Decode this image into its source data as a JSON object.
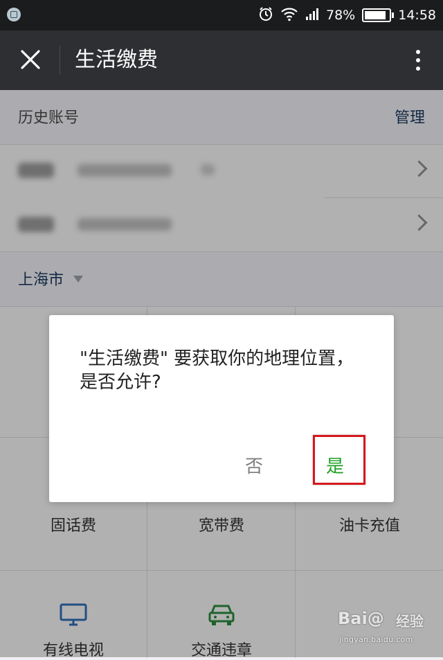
{
  "status_bar": {
    "battery": "78%",
    "time": "14:58"
  },
  "app_bar": {
    "title": "生活缴费"
  },
  "history": {
    "label": "历史账号",
    "manage": "管理"
  },
  "city": {
    "name": "上海市"
  },
  "services": [
    {
      "label": "固话费",
      "icon": "phone-icon"
    },
    {
      "label": "宽带费",
      "icon": "broadband-icon"
    },
    {
      "label": "油卡充值",
      "icon": "fuel-card-icon"
    },
    {
      "label": "有线电视",
      "icon": "tv-icon",
      "color": "#2f6db5"
    },
    {
      "label": "交通违章",
      "icon": "car-icon",
      "color": "#2b8a3e"
    }
  ],
  "dialog": {
    "message": "\"生活缴费\" 要获取你的地理位置，是否允许?",
    "no_label": "否",
    "yes_label": "是"
  },
  "watermark": {
    "logo": "Bai@",
    "cn": "经验",
    "url": "jingyan.baidu.com"
  },
  "colors": {
    "accent_green": "#1da022",
    "highlight_red": "#d6171c",
    "app_bar": "#2d2f33"
  }
}
